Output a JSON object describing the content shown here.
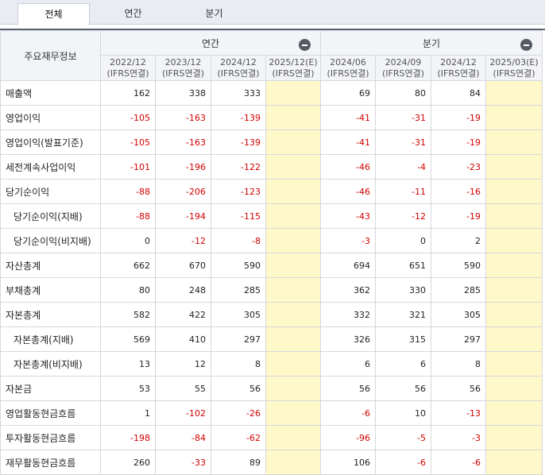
{
  "tabs": [
    {
      "label": "전체",
      "active": true
    },
    {
      "label": "연간",
      "active": false
    },
    {
      "label": "분기",
      "active": false
    }
  ],
  "table": {
    "corner_label": "주요재무정보",
    "groups": [
      {
        "label": "연간",
        "collapse_icon": "minus-circle-icon"
      },
      {
        "label": "분기",
        "collapse_icon": "minus-circle-icon"
      }
    ],
    "periods": [
      {
        "date": "2022/12",
        "basis": "(IFRS연결)"
      },
      {
        "date": "2023/12",
        "basis": "(IFRS연결)"
      },
      {
        "date": "2024/12",
        "basis": "(IFRS연결)"
      },
      {
        "date": "2025/12(E)",
        "basis": "(IFRS연결)"
      },
      {
        "date": "2024/06",
        "basis": "(IFRS연결)"
      },
      {
        "date": "2024/09",
        "basis": "(IFRS연결)"
      },
      {
        "date": "2024/12",
        "basis": "(IFRS연결)"
      },
      {
        "date": "2025/03(E)",
        "basis": "(IFRS연결)"
      }
    ],
    "rows": [
      {
        "label": "매출액",
        "indent": false,
        "values": [
          "162",
          "338",
          "333",
          "",
          "69",
          "80",
          "84",
          ""
        ]
      },
      {
        "label": "영업이익",
        "indent": false,
        "values": [
          "-105",
          "-163",
          "-139",
          "",
          "-41",
          "-31",
          "-19",
          ""
        ]
      },
      {
        "label": "영업이익(발표기준)",
        "indent": false,
        "values": [
          "-105",
          "-163",
          "-139",
          "",
          "-41",
          "-31",
          "-19",
          ""
        ]
      },
      {
        "label": "세전계속사업이익",
        "indent": false,
        "values": [
          "-101",
          "-196",
          "-122",
          "",
          "-46",
          "-4",
          "-23",
          ""
        ]
      },
      {
        "label": "당기순이익",
        "indent": false,
        "values": [
          "-88",
          "-206",
          "-123",
          "",
          "-46",
          "-11",
          "-16",
          ""
        ]
      },
      {
        "label": "당기순이익(지배)",
        "indent": true,
        "values": [
          "-88",
          "-194",
          "-115",
          "",
          "-43",
          "-12",
          "-19",
          ""
        ]
      },
      {
        "label": "당기순이익(비지배)",
        "indent": true,
        "values": [
          "0",
          "-12",
          "-8",
          "",
          "-3",
          "0",
          "2",
          ""
        ]
      },
      {
        "label": "자산총계",
        "indent": false,
        "values": [
          "662",
          "670",
          "590",
          "",
          "694",
          "651",
          "590",
          ""
        ]
      },
      {
        "label": "부채총계",
        "indent": false,
        "values": [
          "80",
          "248",
          "285",
          "",
          "362",
          "330",
          "285",
          ""
        ]
      },
      {
        "label": "자본총계",
        "indent": false,
        "values": [
          "582",
          "422",
          "305",
          "",
          "332",
          "321",
          "305",
          ""
        ]
      },
      {
        "label": "자본총계(지배)",
        "indent": true,
        "values": [
          "569",
          "410",
          "297",
          "",
          "326",
          "315",
          "297",
          ""
        ]
      },
      {
        "label": "자본총계(비지배)",
        "indent": true,
        "values": [
          "13",
          "12",
          "8",
          "",
          "6",
          "6",
          "8",
          ""
        ]
      },
      {
        "label": "자본금",
        "indent": false,
        "values": [
          "53",
          "55",
          "56",
          "",
          "56",
          "56",
          "56",
          ""
        ]
      },
      {
        "label": "영업활동현금흐름",
        "indent": false,
        "values": [
          "1",
          "-102",
          "-26",
          "",
          "-6",
          "10",
          "-13",
          ""
        ]
      },
      {
        "label": "투자활동현금흐름",
        "indent": false,
        "values": [
          "-198",
          "-84",
          "-62",
          "",
          "-96",
          "-5",
          "-3",
          ""
        ]
      },
      {
        "label": "재무활동현금흐름",
        "indent": false,
        "values": [
          "260",
          "-33",
          "89",
          "",
          "106",
          "-6",
          "-6",
          ""
        ]
      }
    ],
    "estimate_columns": [
      3,
      7
    ],
    "colors": {
      "negative": "#d10000",
      "estimate_bg": "#fff8c8",
      "header_bg": "#f2f4f8"
    }
  }
}
